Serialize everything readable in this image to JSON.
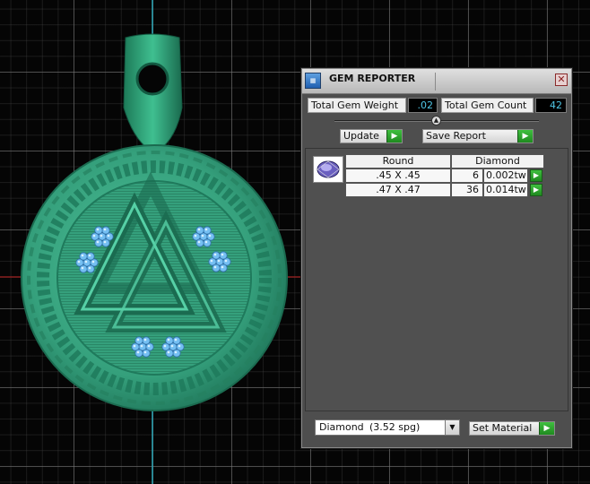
{
  "window": {
    "title": "GEM REPORTER",
    "close_glyph": "✕"
  },
  "totals": {
    "weight_label": "Total Gem Weight",
    "weight_value": ".02",
    "count_label": "Total Gem Count",
    "count_value": "42"
  },
  "buttons": {
    "update_label": "Update",
    "save_report_label": "Save Report",
    "set_material_label": "Set Material",
    "go_glyph": "▶"
  },
  "table": {
    "shape_header": "Round",
    "material_header": "Diamond",
    "rows": [
      {
        "size": ".45 X .45",
        "count": "6",
        "weight": "0.002tw"
      },
      {
        "size": ".47 X .47",
        "count": "36",
        "weight": "0.014tw"
      }
    ]
  },
  "material": {
    "name": "Diamond",
    "spg": "(3.52 spg)"
  },
  "icons": {
    "app": "gem-reporter-app-icon",
    "close": "close-icon",
    "go": "green-play-arrow-icon",
    "dropdown": "chevron-down-icon",
    "thumbnail": "round-diamond-gem-icon"
  },
  "colors": {
    "pendant": "#3aa07d",
    "gem": "#6ab8f0",
    "value_text": "#4fc6e6",
    "go_button": "#2fa02f",
    "panel": "#4e4e4e"
  }
}
